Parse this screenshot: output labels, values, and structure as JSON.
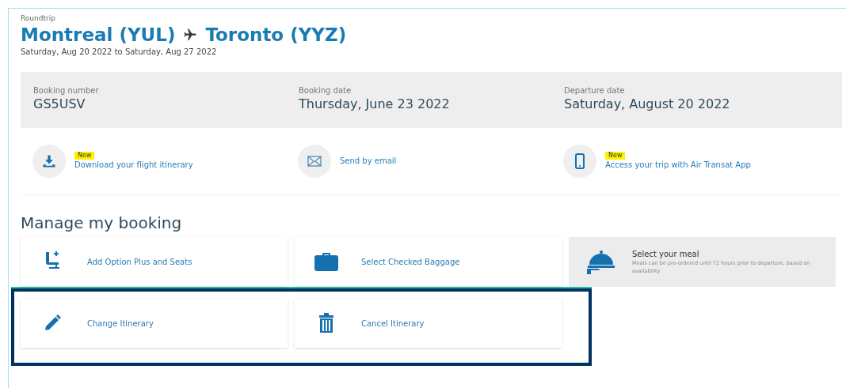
{
  "trip": {
    "type_label": "Roundtrip",
    "origin": "Montreal (YUL)",
    "destination": "Toronto (YYZ)",
    "dates": "Saturday, Aug 20 2022 to Saturday, Aug 27 2022"
  },
  "details": [
    {
      "label": "Booking number",
      "value": "GS5USV"
    },
    {
      "label": "Booking date",
      "value": "Thursday, June 23 2022"
    },
    {
      "label": "Departure date",
      "value": "Saturday, August 20 2022"
    }
  ],
  "actions": [
    {
      "label": "Download your flight itinerary",
      "badge": "New"
    },
    {
      "label": "Send by email"
    },
    {
      "label": "Access your trip with Air Transat App",
      "badge": "New"
    }
  ],
  "manage": {
    "title": "Manage my booking",
    "rows": [
      {
        "highlighted": false,
        "cards": [
          {
            "kind": "link",
            "label": "Add Option Plus and Seats"
          },
          {
            "kind": "link",
            "label": "Select Checked Baggage"
          },
          {
            "kind": "featured",
            "label": "Select your meal",
            "description": "Meals can be pre-ordered until 72 hours prior to departure, based on availability"
          }
        ]
      },
      {
        "highlighted": true,
        "cards": [
          {
            "kind": "link",
            "label": "Change Itinerary"
          },
          {
            "kind": "link",
            "label": "Cancel Itinerary"
          }
        ]
      }
    ]
  }
}
